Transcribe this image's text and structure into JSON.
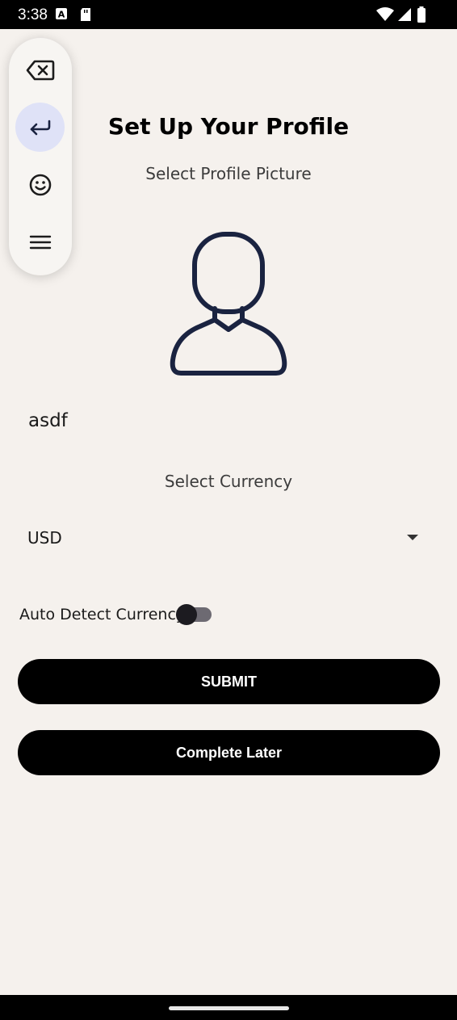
{
  "status_bar": {
    "time": "3:38"
  },
  "keyboard_toolbar": {
    "icons": [
      "backspace-icon",
      "enter-icon",
      "emoji-icon",
      "menu-icon"
    ]
  },
  "profile": {
    "title": "Set Up Your Profile",
    "picture_label": "Select Profile Picture",
    "name_value": "asdf",
    "currency_label": "Select Currency",
    "currency_selected": "USD",
    "auto_detect_label": "Auto Detect Currency",
    "auto_detect_on": false,
    "submit_label": "SUBMIT",
    "later_label": "Complete Later"
  },
  "colors": {
    "background": "#f5f1ed",
    "button": "#000000",
    "avatar_stroke": "#1a2340",
    "toolbar_active": "#dfe2f7"
  }
}
